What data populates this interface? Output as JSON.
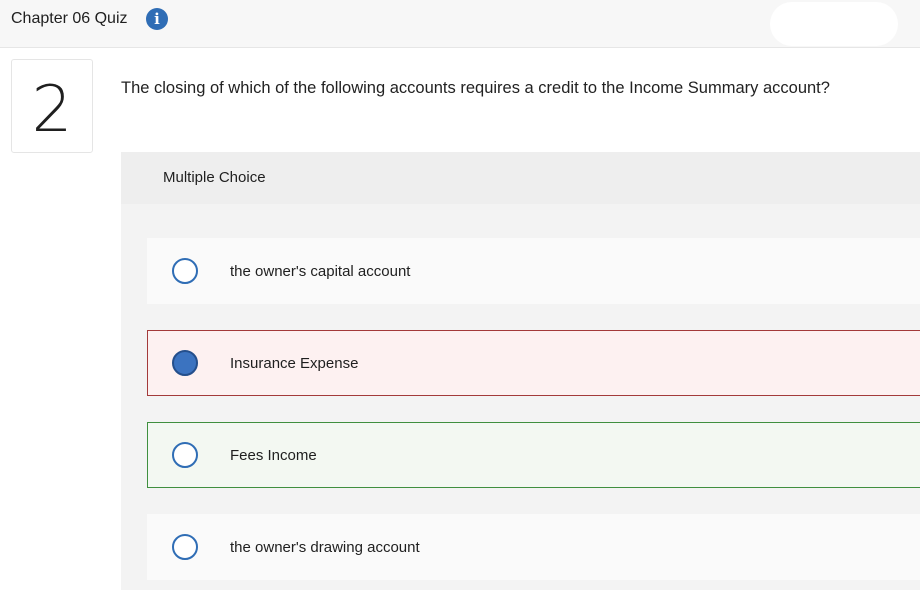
{
  "header": {
    "quiz_title": "Chapter 06 Quiz",
    "info_icon": "info-icon"
  },
  "question": {
    "number": "2",
    "text": "The closing of which of the following accounts requires a credit to the Income Summary account?"
  },
  "answer_area": {
    "type_label": "Multiple Choice",
    "choices": [
      {
        "label": "the owner's capital account",
        "selected": false,
        "state": "default"
      },
      {
        "label": "Insurance Expense",
        "selected": true,
        "state": "incorrect"
      },
      {
        "label": "Fees Income",
        "selected": false,
        "state": "correct"
      },
      {
        "label": "the owner's drawing account",
        "selected": false,
        "state": "default"
      }
    ]
  },
  "colors": {
    "accent": "#2f6db5",
    "incorrect_border": "#a33a3a",
    "incorrect_bg": "#fdf1f1",
    "correct_border": "#3f8f3f",
    "correct_bg": "#f3f8f2"
  }
}
